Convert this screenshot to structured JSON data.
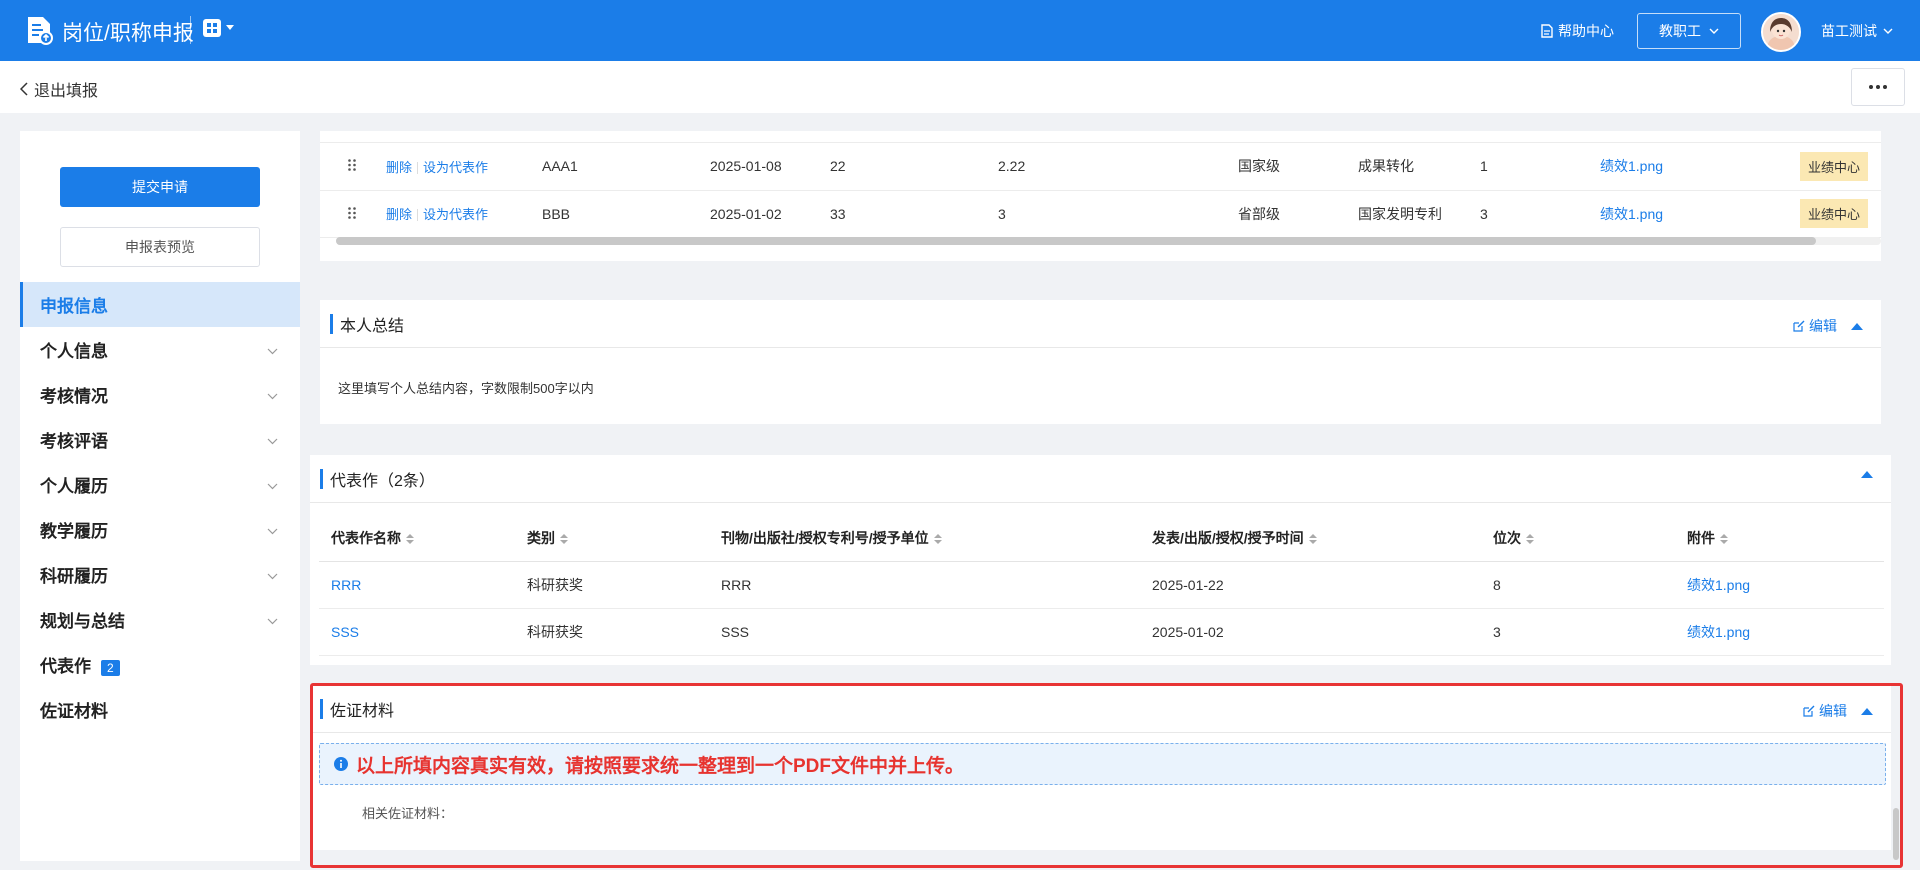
{
  "header": {
    "app_title": "岗位/职称申报",
    "help_label": "帮助中心",
    "role_label": "教职工",
    "user_name": "苗工测试"
  },
  "subheader": {
    "exit_label": "退出填报"
  },
  "sidebar": {
    "submit_label": "提交申请",
    "preview_label": "申报表预览",
    "items": [
      {
        "label": "申报信息",
        "active": true,
        "chevron": false
      },
      {
        "label": "个人信息",
        "chevron": true
      },
      {
        "label": "考核情况",
        "chevron": true
      },
      {
        "label": "考核评语",
        "chevron": true
      },
      {
        "label": "个人履历",
        "chevron": true
      },
      {
        "label": "教学履历",
        "chevron": true
      },
      {
        "label": "科研履历",
        "chevron": true
      },
      {
        "label": "规划与总结",
        "chevron": true
      },
      {
        "label": "代表作",
        "badge": "2",
        "chevron": false
      },
      {
        "label": "佐证材料",
        "chevron": false
      }
    ]
  },
  "achievements": {
    "delete_label": "删除",
    "set_rep_label": "设为代表作",
    "rows": [
      {
        "name": "AAA1",
        "date": "2025-01-08",
        "v1": "22",
        "v2": "2.22",
        "level": "国家级",
        "type": "成果转化",
        "rank": "1",
        "file": "绩效1.png",
        "tag": "业绩中心"
      },
      {
        "name": "BBB",
        "date": "2025-01-02",
        "v1": "33",
        "v2": "3",
        "level": "省部级",
        "type": "国家发明专利",
        "rank": "3",
        "file": "绩效1.png",
        "tag": "业绩中心"
      }
    ]
  },
  "summary": {
    "title": "本人总结",
    "edit_label": "编辑",
    "content": "这里填写个人总结内容，字数限制500字以内"
  },
  "representative": {
    "title": "代表作（2条）",
    "columns": [
      "代表作名称",
      "类别",
      "刊物/出版社/授权专利号/授予单位",
      "发表/出版/授权/授予时间",
      "位次",
      "附件"
    ],
    "rows": [
      {
        "name": "RRR",
        "category": "科研获奖",
        "publisher": "RRR",
        "date": "2025-01-22",
        "rank": "8",
        "file": "绩效1.png"
      },
      {
        "name": "SSS",
        "category": "科研获奖",
        "publisher": "SSS",
        "date": "2025-01-02",
        "rank": "3",
        "file": "绩效1.png"
      }
    ]
  },
  "evidence": {
    "title": "佐证材料",
    "edit_label": "编辑",
    "notice": "以上所填内容真实有效，请按照要求统一整理到一个PDF文件中并上传。",
    "field_label": "相关佐证材料："
  },
  "colors": {
    "primary": "#1b7de8",
    "warning_text": "#e7332f",
    "highlight_border": "#e83434",
    "tag_bg": "#fbe8b3"
  }
}
